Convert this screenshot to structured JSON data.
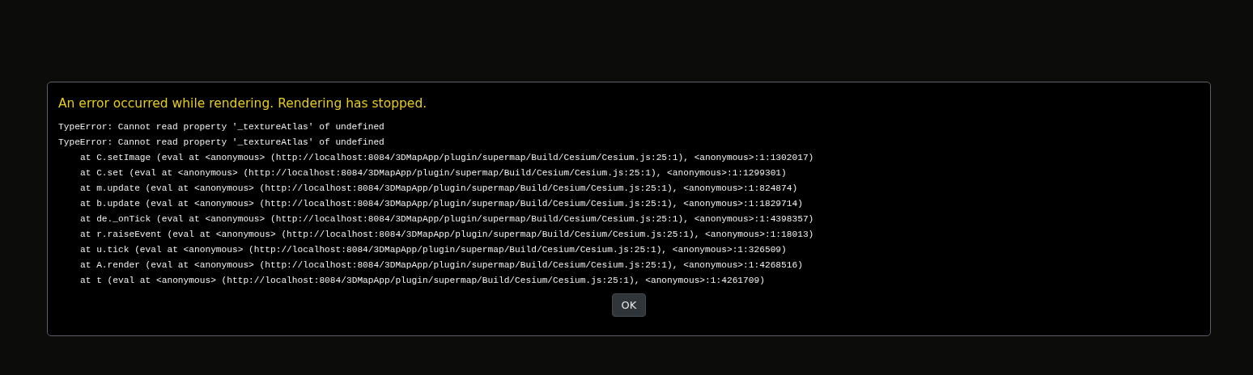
{
  "dialog": {
    "title": "An error occurred while rendering. Rendering has stopped.",
    "messages": [
      "TypeError: Cannot read property '_textureAtlas' of undefined",
      "TypeError: Cannot read property '_textureAtlas' of undefined"
    ],
    "stack": [
      "at C.setImage (eval at <anonymous> (http://localhost:8084/3DMapApp/plugin/supermap/Build/Cesium/Cesium.js:25:1), <anonymous>:1:1302017)",
      "at C.set (eval at <anonymous> (http://localhost:8084/3DMapApp/plugin/supermap/Build/Cesium/Cesium.js:25:1), <anonymous>:1:1299301)",
      "at m.update (eval at <anonymous> (http://localhost:8084/3DMapApp/plugin/supermap/Build/Cesium/Cesium.js:25:1), <anonymous>:1:824874)",
      "at b.update (eval at <anonymous> (http://localhost:8084/3DMapApp/plugin/supermap/Build/Cesium/Cesium.js:25:1), <anonymous>:1:1829714)",
      "at de._onTick (eval at <anonymous> (http://localhost:8084/3DMapApp/plugin/supermap/Build/Cesium/Cesium.js:25:1), <anonymous>:1:4398357)",
      "at r.raiseEvent (eval at <anonymous> (http://localhost:8084/3DMapApp/plugin/supermap/Build/Cesium/Cesium.js:25:1), <anonymous>:1:18013)",
      "at u.tick (eval at <anonymous> (http://localhost:8084/3DMapApp/plugin/supermap/Build/Cesium/Cesium.js:25:1), <anonymous>:1:326509)",
      "at A.render (eval at <anonymous> (http://localhost:8084/3DMapApp/plugin/supermap/Build/Cesium/Cesium.js:25:1), <anonymous>:1:4268516)",
      "at t (eval at <anonymous> (http://localhost:8084/3DMapApp/plugin/supermap/Build/Cesium/Cesium.js:25:1), <anonymous>:1:4261709)"
    ],
    "button": "OK"
  }
}
